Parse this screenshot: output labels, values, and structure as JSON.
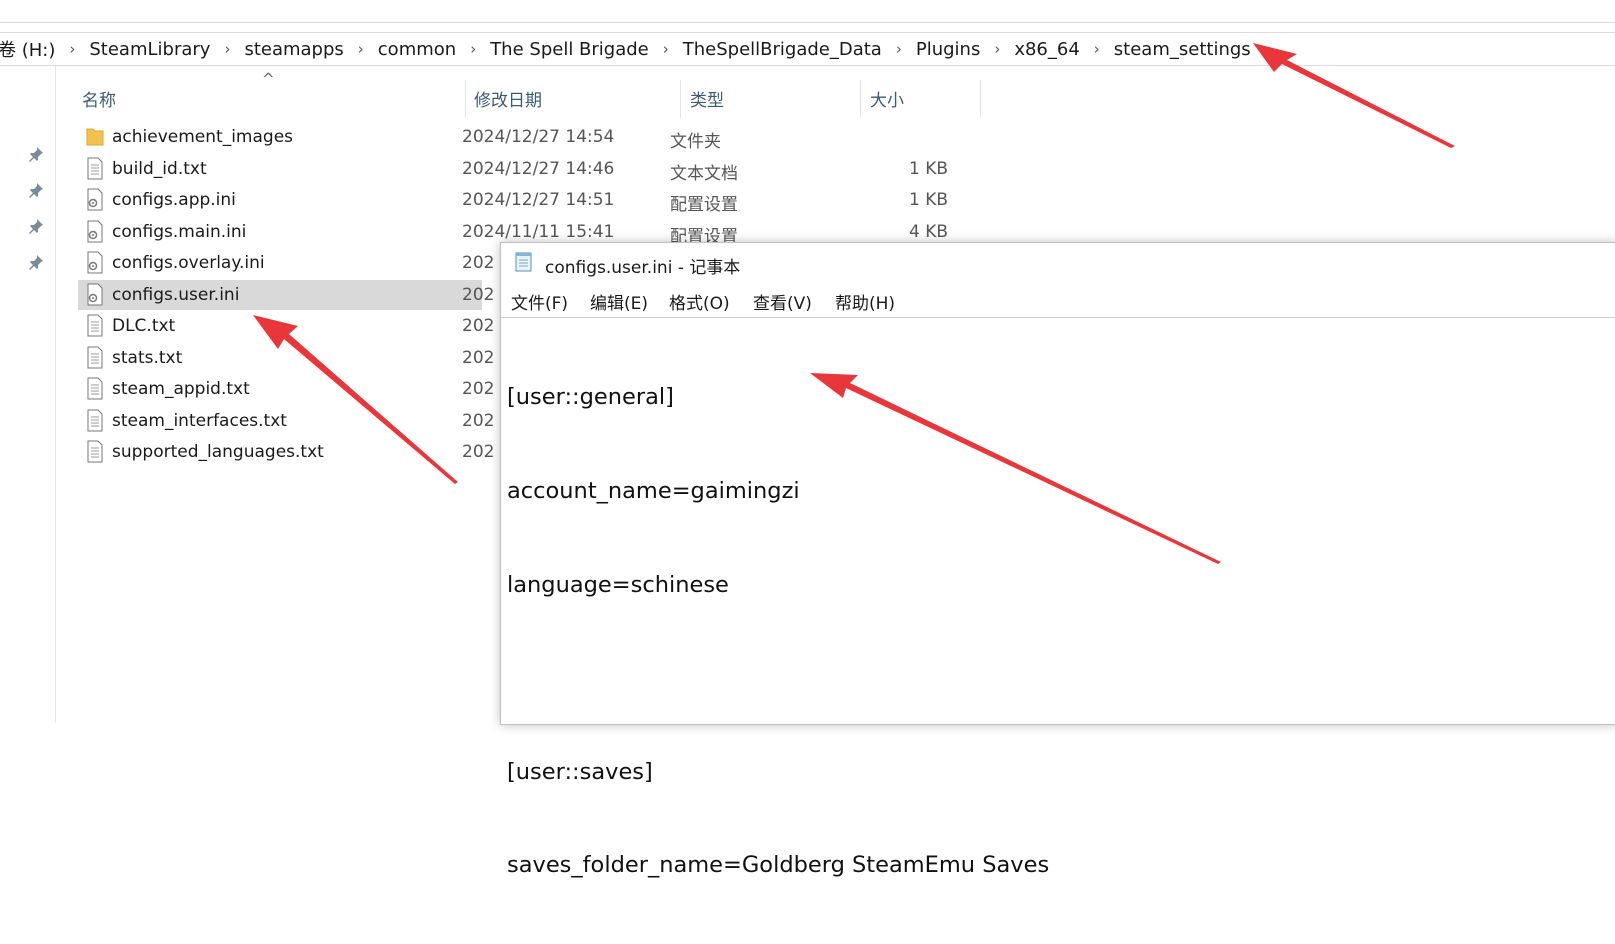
{
  "address_bar": {
    "crumbs": [
      "卷 (H:)",
      "SteamLibrary",
      "steamapps",
      "common",
      "The Spell Brigade",
      "TheSpellBrigade_Data",
      "Plugins",
      "x86_64",
      "steam_settings"
    ]
  },
  "columns": {
    "name": "名称",
    "modified": "修改日期",
    "type": "类型",
    "size": "大小"
  },
  "files": [
    {
      "name": "achievement_images",
      "date": "2024/12/27 14:54",
      "type": "文件夹",
      "size": "",
      "icon": "folder-icon"
    },
    {
      "name": "build_id.txt",
      "date": "2024/12/27 14:46",
      "type": "文本文档",
      "size": "1 KB",
      "icon": "text-file-icon"
    },
    {
      "name": "configs.app.ini",
      "date": "2024/12/27 14:51",
      "type": "配置设置",
      "size": "1 KB",
      "icon": "settings-file-icon"
    },
    {
      "name": "configs.main.ini",
      "date": "2024/11/11 15:41",
      "type": "配置设置",
      "size": "4 KB",
      "icon": "settings-file-icon"
    },
    {
      "name": "configs.overlay.ini",
      "date": "202",
      "type": "",
      "size": "",
      "icon": "settings-file-icon"
    },
    {
      "name": "configs.user.ini",
      "date": "202",
      "type": "",
      "size": "",
      "icon": "settings-file-icon"
    },
    {
      "name": "DLC.txt",
      "date": "202",
      "type": "",
      "size": "",
      "icon": "text-file-icon"
    },
    {
      "name": "stats.txt",
      "date": "202",
      "type": "",
      "size": "",
      "icon": "text-file-icon"
    },
    {
      "name": "steam_appid.txt",
      "date": "202",
      "type": "",
      "size": "",
      "icon": "text-file-icon"
    },
    {
      "name": "steam_interfaces.txt",
      "date": "202",
      "type": "",
      "size": "",
      "icon": "text-file-icon"
    },
    {
      "name": "supported_languages.txt",
      "date": "202",
      "type": "",
      "size": "",
      "icon": "text-file-icon"
    }
  ],
  "notepad": {
    "title": "configs.user.ini - 记事本",
    "menus": [
      "文件(F)",
      "编辑(E)",
      "格式(O)",
      "查看(V)",
      "帮助(H)"
    ],
    "lines": [
      "[user::general]",
      "account_name=gaimingzi",
      "language=schinese",
      "",
      "[user::saves]",
      "saves_folder_name=Goldberg SteamEmu Saves"
    ]
  },
  "colors": {
    "selection": "#d9d9d9",
    "arrow": "#e8363a",
    "folder": "#f2c24f"
  }
}
